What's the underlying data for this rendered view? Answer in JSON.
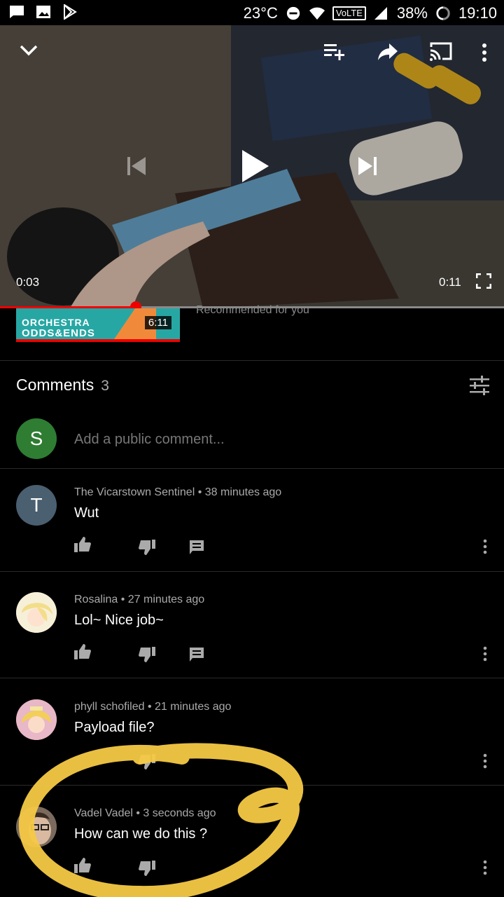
{
  "status_bar": {
    "temperature": "23°C",
    "volte": "VoLTE",
    "battery": "38%",
    "time": "19:10"
  },
  "player": {
    "current_time": "0:03",
    "duration": "0:11",
    "progress": 0.27
  },
  "recommended": {
    "thumbnail_line1": "ORCHESTRA",
    "thumbnail_line2": "ODDS&ENDS",
    "duration": "6:11",
    "label": "Recommended for you"
  },
  "comments": {
    "title": "Comments",
    "count": "3",
    "input_avatar_letter": "S",
    "input_placeholder": "Add a public comment...",
    "items": [
      {
        "author": "The Vicarstown Sentinel",
        "age": "38 minutes ago",
        "text": "Wut",
        "avatar_letter": "T"
      },
      {
        "author": "Rosalina",
        "age": "27 minutes ago",
        "text": "Lol~ Nice job~",
        "avatar_letter": ""
      },
      {
        "author": "phyll schofiled",
        "age": "21 minutes ago",
        "text": "Payload file?",
        "avatar_letter": ""
      },
      {
        "author": "Vadel Vadel",
        "age": "3 seconds ago",
        "text": "How can we do this ?",
        "avatar_letter": ""
      }
    ]
  },
  "colors": {
    "accent_red": "#ee0000",
    "annotation_yellow": "#f6c945",
    "avatar_green": "#2e7d32",
    "avatar_slate": "#4a5f70"
  }
}
